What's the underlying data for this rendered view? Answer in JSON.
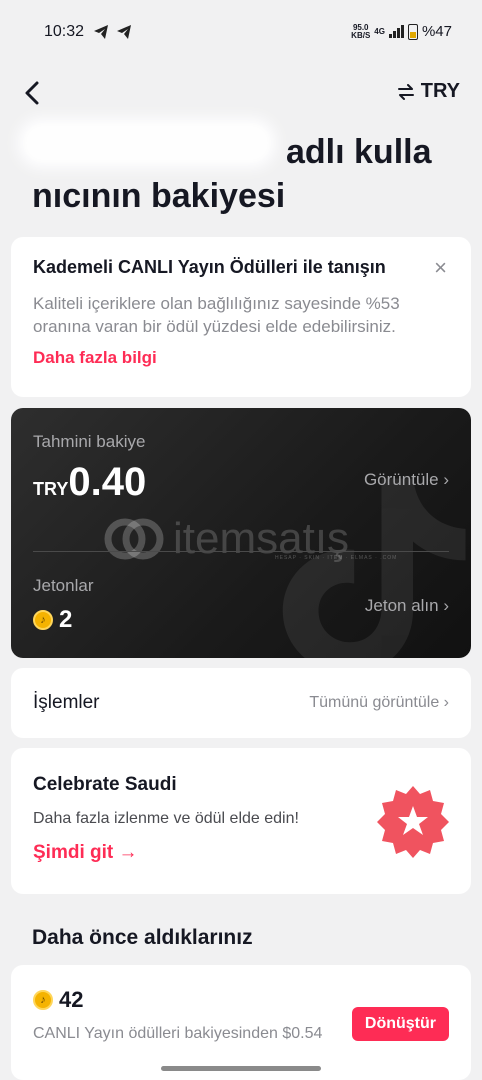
{
  "status_bar": {
    "time": "10:32",
    "net_speed_top": "95.0",
    "net_speed_bottom": "KB/S",
    "network": "4G",
    "battery": "%47"
  },
  "header": {
    "currency": "TRY",
    "title_line1": "adlı kulla",
    "title_line2": "nıcının bakiyesi"
  },
  "promo": {
    "title": "Kademeli CANLI Yayın Ödülleri ile tanışın",
    "body": "Kaliteli içeriklere olan bağlılığınız sayesinde %53 oranına varan bir ödül yüzdesi elde edebilirsiniz.",
    "link": "Daha fazla bilgi",
    "close": "×"
  },
  "balance": {
    "label": "Tahmini bakiye",
    "currency_code": "TRY",
    "amount": "0.40",
    "view_label": "Görüntüle ›",
    "coins_label": "Jetonlar",
    "coins_count": "2",
    "get_coins_label": "Jeton alın ›",
    "watermark_text": "itemsatış",
    "watermark_sub": "HESAP · SKIN · ITEM · ELMAS · .COM"
  },
  "transactions": {
    "title": "İşlemler",
    "view_all": "Tümünü görüntüle ›"
  },
  "celebrate": {
    "title": "Celebrate Saudi",
    "body": "Daha fazla izlenme ve ödül elde edin!",
    "link": "Şimdi git →"
  },
  "previous": {
    "section_title": "Daha önce aldıklarınız",
    "coins": "42",
    "desc": "CANLI Yayın ödülleri bakiyesinden $0.54",
    "convert_label": "Dönüştür"
  },
  "colors": {
    "accent": "#fe2c55",
    "coin": "#f5b301",
    "card_dark": "#1a1a1a"
  }
}
